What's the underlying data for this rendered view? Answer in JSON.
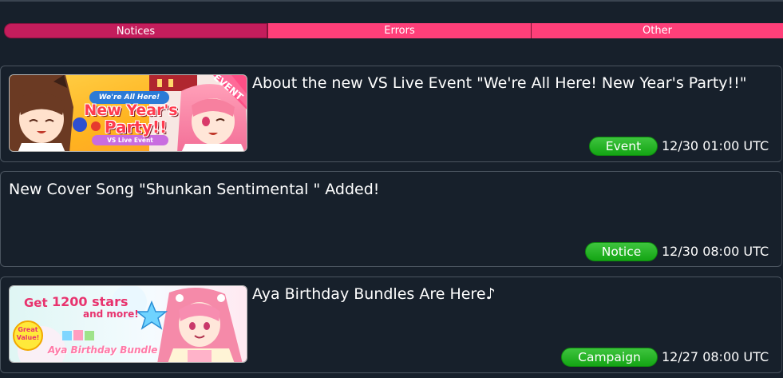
{
  "tabs": [
    {
      "label": "Notices"
    },
    {
      "label": "Errors"
    },
    {
      "label": "Other"
    }
  ],
  "notices": [
    {
      "title": "About the new VS Live Event \"We're All Here! New Year's Party!!\"",
      "tag": "Event",
      "time": "12/30 01:00 UTC",
      "banner": {
        "headline": "We're All Here!",
        "line1": "New Year's",
        "line2": "Party!!",
        "sub": "VS Live Event",
        "ribbon": "EVENT"
      }
    },
    {
      "title": "New Cover Song \"Shunkan Sentimental \" Added!",
      "tag": "Notice",
      "time": "12/30 08:00 UTC"
    },
    {
      "title": "Aya Birthday Bundles Are Here♪",
      "tag": "Campaign",
      "time": "12/27 08:00 UTC",
      "banner": {
        "get": "Get",
        "stars": "1200 stars",
        "more": "and more!",
        "great1": "Great",
        "great2": "Value!",
        "bundle": "Aya Birthday Bundle"
      }
    }
  ],
  "colors": {
    "background": "#17202b",
    "tab_active": "#c41d5c",
    "tab_inactive": "#ff3f79",
    "badge": "#22b022"
  }
}
